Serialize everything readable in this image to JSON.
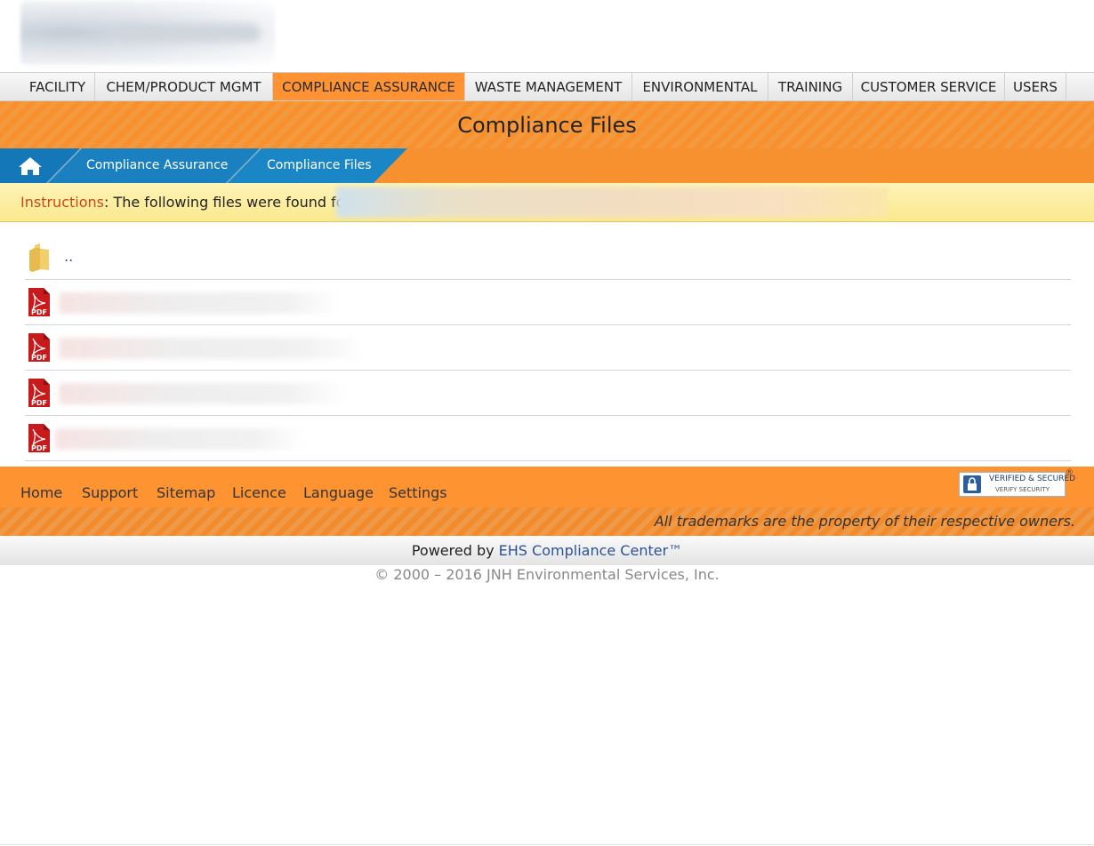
{
  "nav": {
    "items": [
      {
        "label": "FACILITY",
        "active": false
      },
      {
        "label": "CHEM/PRODUCT MGMT",
        "active": false
      },
      {
        "label": "COMPLIANCE ASSURANCE",
        "active": true
      },
      {
        "label": "WASTE MANAGEMENT",
        "active": false
      },
      {
        "label": "ENVIRONMENTAL",
        "active": false
      },
      {
        "label": "TRAINING",
        "active": false
      },
      {
        "label": "CUSTOMER SERVICE",
        "active": false
      },
      {
        "label": "USERS",
        "active": false
      }
    ]
  },
  "page": {
    "title": "Compliance Files"
  },
  "breadcrumb": {
    "home_icon": "home-icon",
    "items": [
      "Compliance Assurance",
      "Compliance Files"
    ]
  },
  "instructions": {
    "label": "Instructions",
    "text": ": The following files were found for"
  },
  "files": {
    "parent_label": "..",
    "folder_icon": "folder-icon",
    "pdf_icon": "pdf-icon",
    "pdf_icon_label": "PDF"
  },
  "footer": {
    "links": [
      "Home",
      "Support",
      "Sitemap",
      "Licence",
      "Language",
      "Settings"
    ],
    "badge": {
      "line1": "VERIFIED & SECURED",
      "line2": "VERIFY SECURITY",
      "reg": "®"
    },
    "trademark": "All trademarks are the property of their respective owners.",
    "powered_prefix": "Powered by ",
    "powered_link": "EHS Compliance Center™",
    "copyright": "© 2000 – 2016 JNH Environmental Services, Inc."
  },
  "colors": {
    "accent_orange": "#f7912f",
    "breadcrumb_blue": "#1477b8",
    "link_blue": "#2b5297",
    "instruction_label": "#c9481b"
  }
}
